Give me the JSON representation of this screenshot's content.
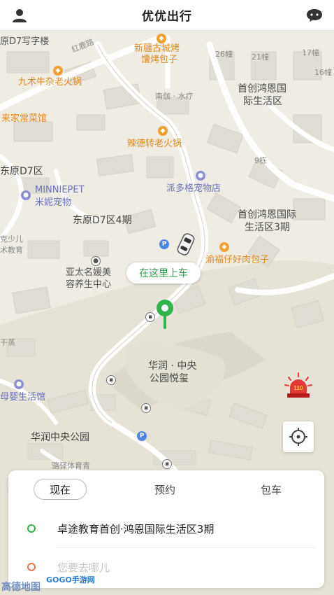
{
  "header": {
    "title": "优优出行",
    "profile_icon": "user-icon",
    "message_icon": "chat-icon"
  },
  "map": {
    "labels": {
      "d7_building": "原D7写字楼",
      "honglu": "红鹿路",
      "xinjiang": "新疆古城烤",
      "nang": "馕烤包子",
      "b26": "26幢",
      "b21": "21幢",
      "b17": "17幢",
      "b16": "16幢",
      "jiushu": "九术牛杂老火锅",
      "nanjia": "南伽 · 水疗",
      "shouchuang": "首创鸿恩国",
      "shouchuang2": "际生活区",
      "laijia": "来家常菜馆",
      "lade": "辣德转老火锅",
      "b9": "9栋",
      "d7area": "东原D7区",
      "paiduo": "派多格宠物店",
      "minnie": "MINNIEPET",
      "minnie_cn": "米妮宠物",
      "sc3a": "首创鸿恩国际",
      "sc3b": "生活区3期",
      "d7p4": "东原D7区4期",
      "kelong": "克少儿",
      "kelong2": "术教育",
      "yufu": "渝福仔好肉包子",
      "yatai": "亚太名媛美",
      "yatai2": "容养生中心",
      "ganzheng": "干蒸",
      "huarun_yue": "华润 · 中央",
      "huarun_yue2": "公园悦玺",
      "muying": "母婴生活馆",
      "huarun_park": "华润中央公园",
      "tiyu": "骆驿体育青"
    },
    "pickup_tip": "在这里上车",
    "police_label": "110"
  },
  "panel": {
    "tabs": [
      "现在",
      "预约",
      "包车"
    ],
    "active_tab": 0,
    "origin": "卓途教育首创·鸿恩国际生活区3期",
    "destination_placeholder": "您要去哪儿",
    "origin_color": "#2fb34a",
    "destination_color": "#e8734a"
  },
  "watermark": {
    "site": "GOGO手游网",
    "amap": "高德地图"
  }
}
